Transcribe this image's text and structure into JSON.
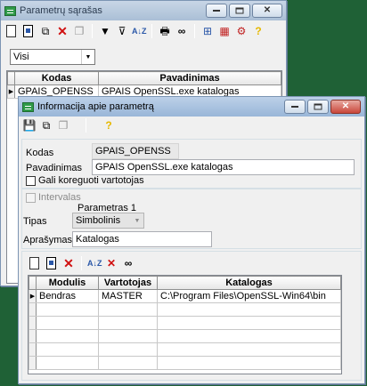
{
  "back_window": {
    "title": "Parametrų sąrašas",
    "filter_value": "Visi",
    "columns": [
      "Kodas",
      "Pavadinimas"
    ],
    "rows": [
      {
        "kodas": "GPAIS_OPENSS",
        "pavadinimas": "GPAIS OpenSSL.exe katalogas"
      }
    ]
  },
  "front_window": {
    "title": "Informacija apie parametrą",
    "kodas_label": "Kodas",
    "kodas_value": "GPAIS_OPENSS",
    "pavadinimas_label": "Pavadinimas",
    "pavadinimas_value": "GPAIS OpenSSL.exe katalogas",
    "editable_checkbox_label": "Gali koreguoti vartotojas",
    "intervalas_label": "Intervalas",
    "parametras_header": "Parametras 1",
    "tipas_label": "Tipas",
    "tipas_value": "Simbolinis",
    "aprasymas_label": "Aprašymas",
    "aprasymas_value": "Katalogas",
    "grid_columns": [
      "Modulis",
      "Vartotojas",
      "Katalogas"
    ],
    "grid_rows": [
      {
        "modulis": "Bendras",
        "vartotojas": "MASTER",
        "katalogas": "C:\\Program Files\\OpenSSL-Win64\\bin"
      }
    ]
  },
  "icons": {
    "new": "new-doc-icon",
    "edit": "edit-doc-icon",
    "delete": "delete-icon",
    "filter": "filter-icon",
    "sort": "sort-az-icon",
    "print": "printer-icon",
    "find": "binoculars-icon",
    "help": "help-icon",
    "save": "save-icon"
  },
  "colors": {
    "desktop": "#1f6136",
    "delete": "#d01010",
    "help": "#e6b800"
  }
}
